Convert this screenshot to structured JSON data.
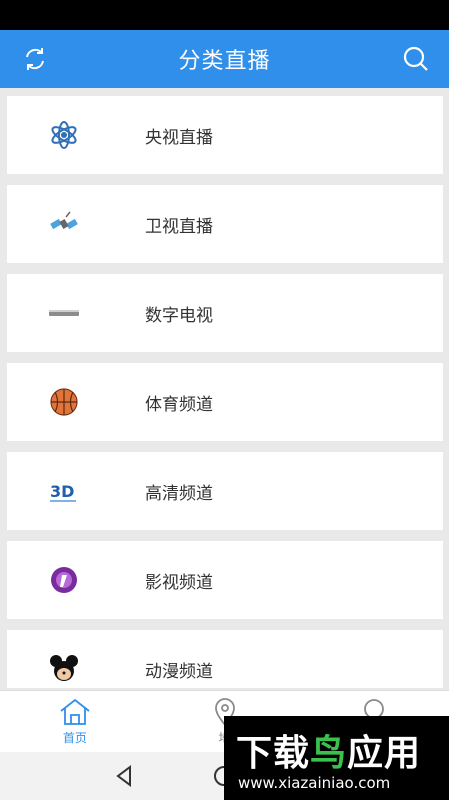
{
  "header": {
    "title": "分类直播"
  },
  "categories": [
    {
      "label": "央视直播",
      "icon": "atom-icon"
    },
    {
      "label": "卫视直播",
      "icon": "satellite-icon"
    },
    {
      "label": "数字电视",
      "icon": "set-top-box-icon"
    },
    {
      "label": "体育频道",
      "icon": "basketball-icon"
    },
    {
      "label": "高清频道",
      "icon": "3d-icon"
    },
    {
      "label": "影视频道",
      "icon": "film-reel-icon"
    },
    {
      "label": "动漫频道",
      "icon": "mickey-icon"
    }
  ],
  "tabs": [
    {
      "label": "首页",
      "icon": "home-icon",
      "active": true
    },
    {
      "label": "地",
      "icon": "location-icon",
      "active": false
    },
    {
      "label": "",
      "icon": "profile-icon",
      "active": false
    }
  ],
  "watermark": {
    "title_part1": "下载",
    "title_part2": "鸟",
    "title_part3": "应用",
    "url": "www.xiazainiao.com"
  },
  "colors": {
    "primary": "#2f8fea",
    "background": "#e9e9e9",
    "text": "#333333"
  }
}
